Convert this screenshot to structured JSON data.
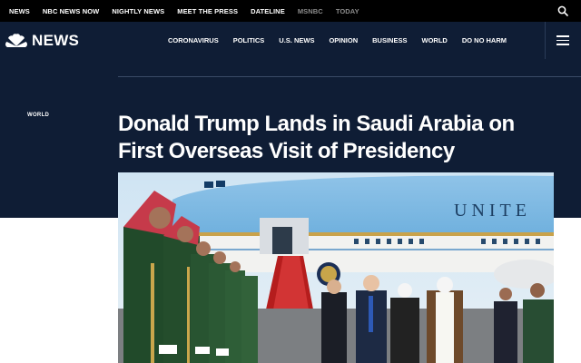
{
  "topbar": {
    "links": [
      {
        "label": "NEWS"
      },
      {
        "label": "NBC NEWS NOW"
      },
      {
        "label": "NIGHTLY NEWS"
      },
      {
        "label": "MEET THE PRESS"
      },
      {
        "label": "DATELINE"
      },
      {
        "label": "MSNBC"
      },
      {
        "label": "TODAY"
      }
    ],
    "search_icon": "search-icon"
  },
  "brand": {
    "logo_icon": "nbc-peacock-icon",
    "wordmark": "NEWS"
  },
  "nav": {
    "items": [
      {
        "label": "CORONAVIRUS"
      },
      {
        "label": "POLITICS"
      },
      {
        "label": "U.S. NEWS"
      },
      {
        "label": "OPINION"
      },
      {
        "label": "BUSINESS"
      },
      {
        "label": "WORLD"
      },
      {
        "label": "DO NO HARM"
      }
    ],
    "menu_icon": "hamburger-menu-icon"
  },
  "article": {
    "section": "WORLD",
    "headline": "Donald Trump Lands in Saudi Arabia on First Overseas Visit of Presidency",
    "photo": {
      "aircraft_lettering": "UNITE"
    }
  },
  "colors": {
    "topbar_bg": "#000000",
    "nav_bg": "#0f1d35",
    "muted_link": "#8c8c8c"
  }
}
